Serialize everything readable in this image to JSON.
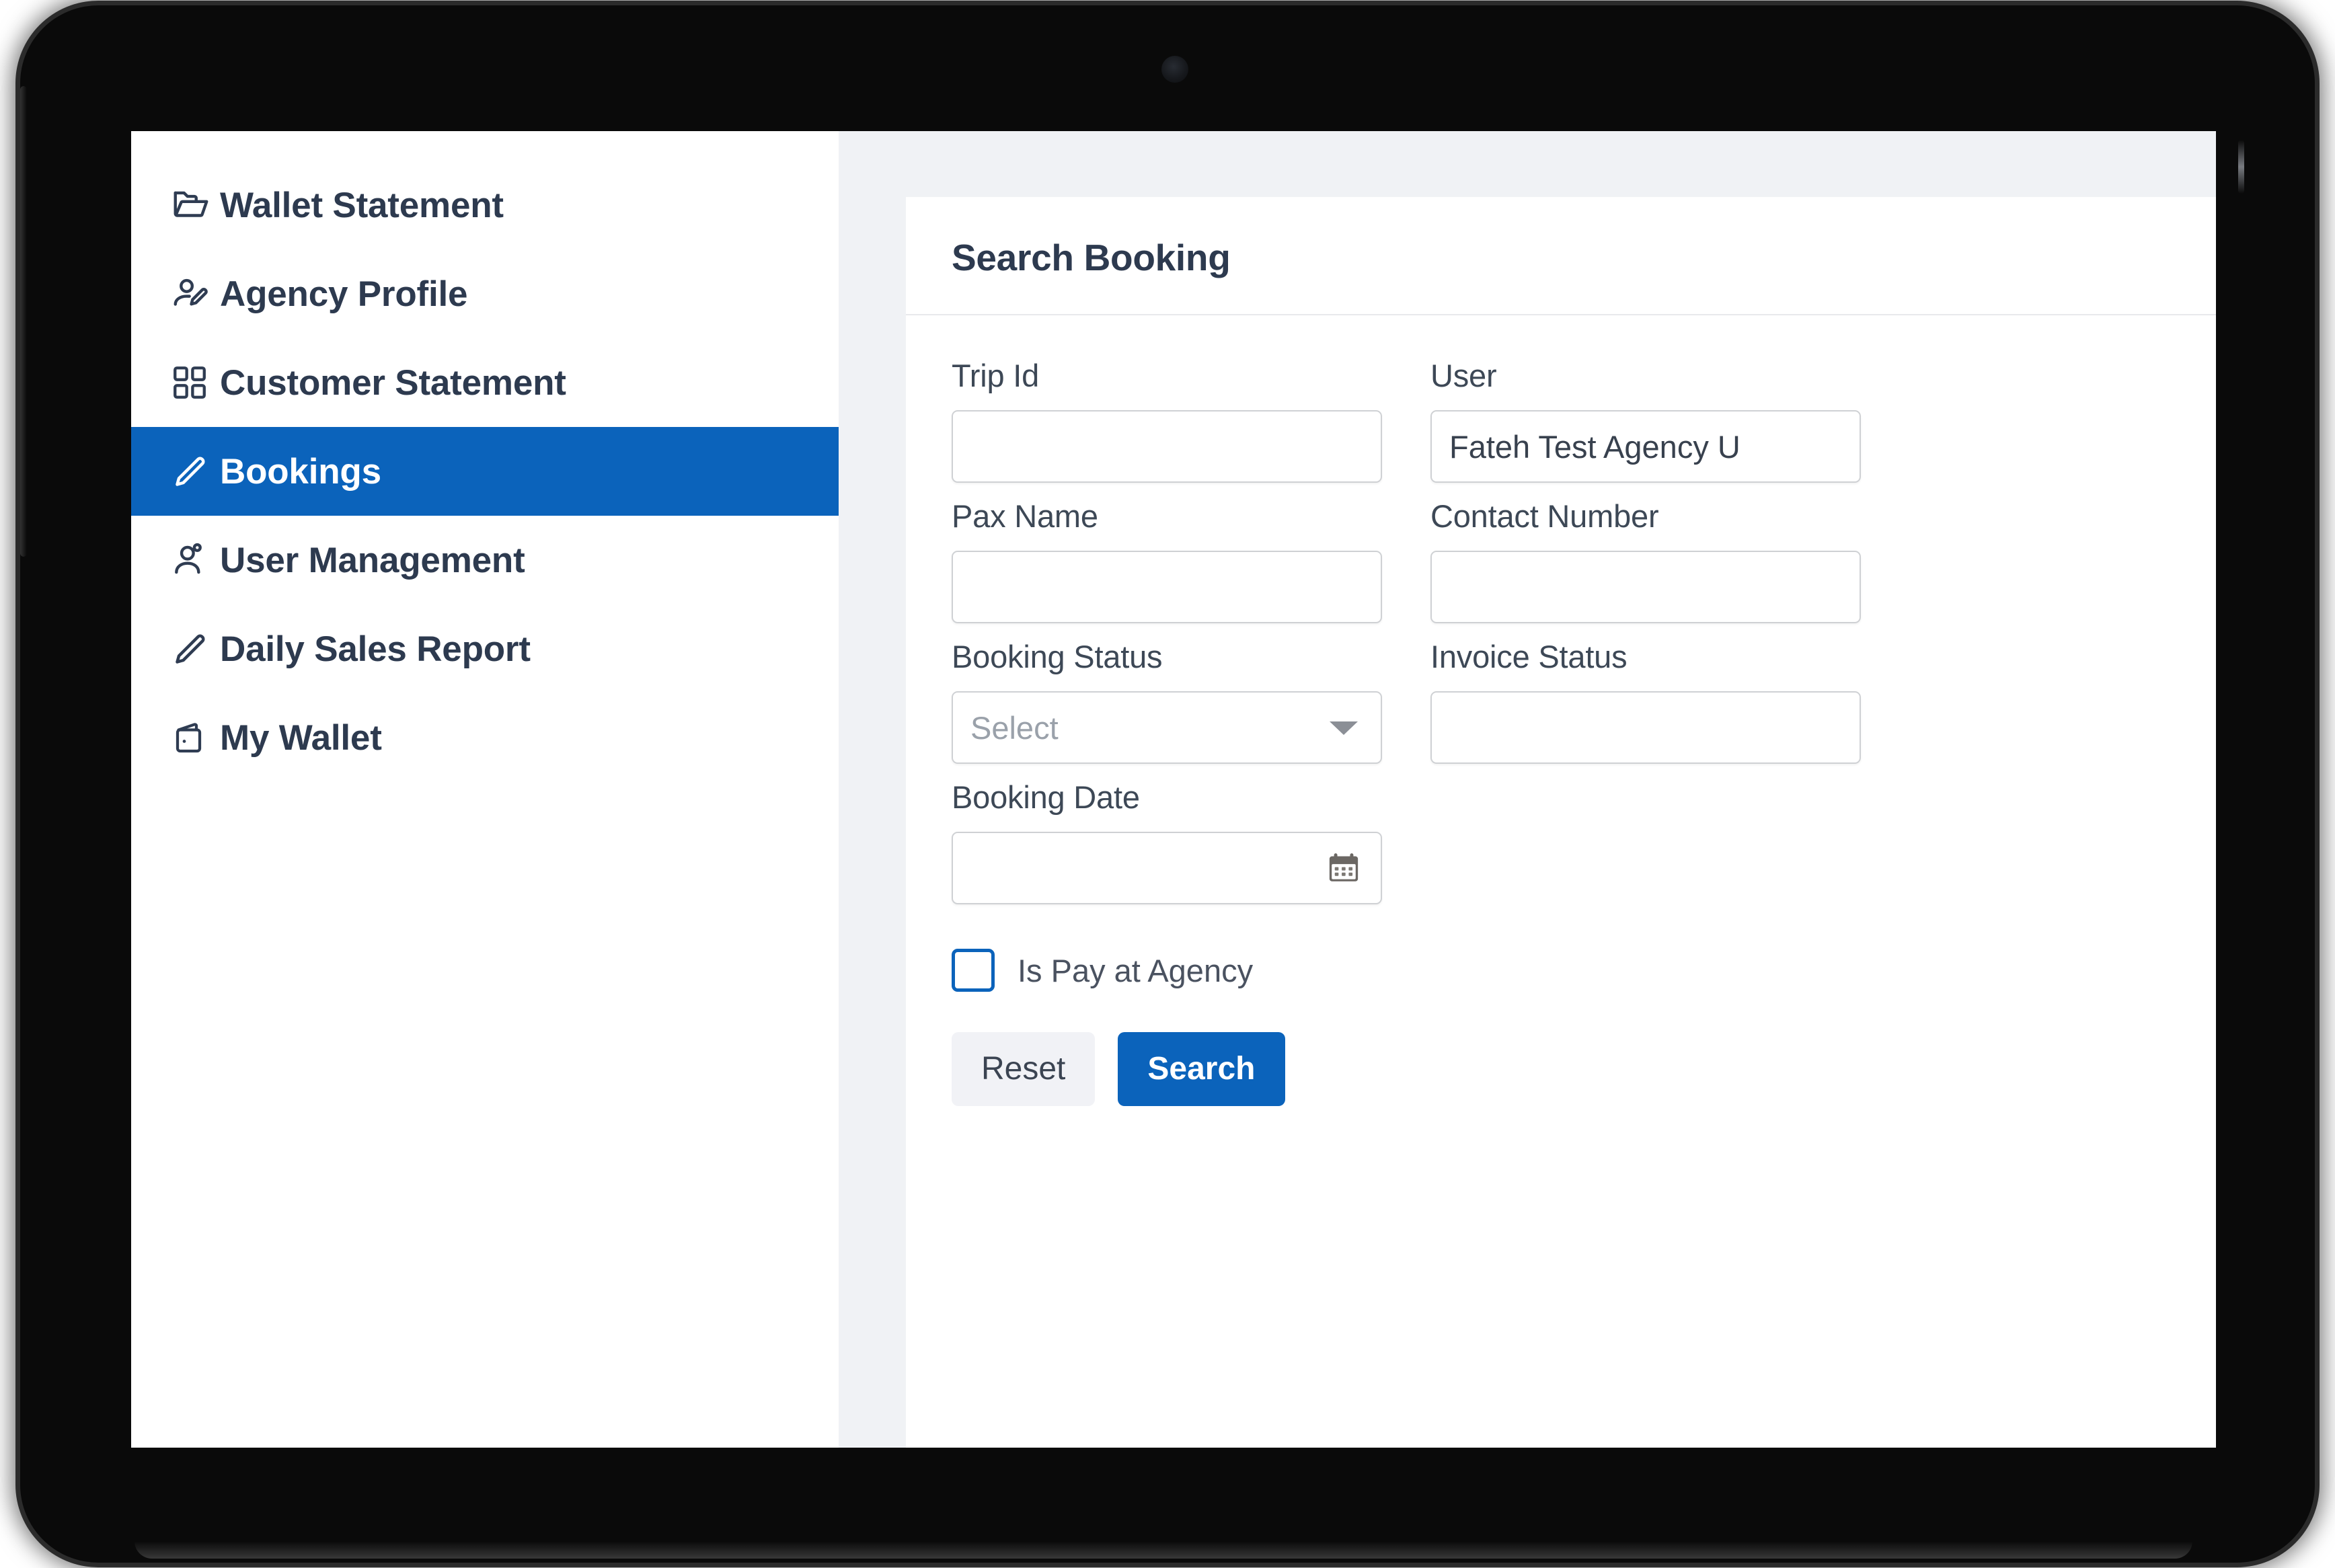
{
  "device": {
    "type": "tablet",
    "bezel_color": "#0a0a0a",
    "camera": "front-camera-dot"
  },
  "theme": {
    "accent": "#0b63bb",
    "sidebar_bg": "#ffffff",
    "page_bg": "#f0f2f5",
    "text": "#2d3a4f",
    "muted_text": "#9aa1aa",
    "border": "#cfd1d4"
  },
  "sidebar": {
    "items": [
      {
        "label": "Wallet Statement",
        "icon": "folder-open-icon",
        "active": false
      },
      {
        "label": "Agency Profile",
        "icon": "user-edit-icon",
        "active": false
      },
      {
        "label": "Customer Statement",
        "icon": "grid-icon",
        "active": false
      },
      {
        "label": "Bookings",
        "icon": "pencil-icon",
        "active": true
      },
      {
        "label": "User Management",
        "icon": "users-icon",
        "active": false
      },
      {
        "label": "Daily Sales Report",
        "icon": "pencil-icon",
        "active": false
      },
      {
        "label": "My Wallet",
        "icon": "wallet-icon",
        "active": false
      }
    ]
  },
  "main": {
    "card_title": "Search Booking",
    "fields": {
      "trip_id": {
        "label": "Trip Id",
        "value": "",
        "placeholder": "",
        "type": "text"
      },
      "user": {
        "label": "User",
        "value": "Fateh Test Agency U",
        "placeholder": "",
        "type": "text"
      },
      "pax_name": {
        "label": "Pax Name",
        "value": "",
        "placeholder": "",
        "type": "text"
      },
      "contact_number": {
        "label": "Contact Number",
        "value": "",
        "placeholder": "",
        "type": "text"
      },
      "booking_status": {
        "label": "Booking Status",
        "value": "",
        "placeholder": "Select",
        "type": "select"
      },
      "invoice_status": {
        "label": "Invoice Status",
        "value": "",
        "placeholder": "",
        "type": "select"
      },
      "booking_date": {
        "label": "Booking Date",
        "value": "",
        "placeholder": "",
        "type": "date",
        "icon": "calendar-icon"
      }
    },
    "checkbox": {
      "label": "Is Pay at Agency",
      "checked": false
    },
    "buttons": {
      "reset": "Reset",
      "search": "Search"
    }
  }
}
